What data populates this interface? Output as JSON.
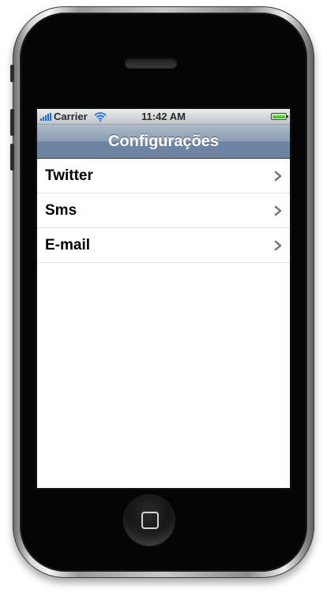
{
  "status_bar": {
    "carrier": "Carrier",
    "time": "11:42 AM",
    "battery_level": 1.0,
    "signal_icon": "signal-bars-icon",
    "wifi_icon": "wifi-icon",
    "battery_icon": "battery-icon"
  },
  "nav": {
    "title": "Configurações"
  },
  "settings": {
    "items": [
      {
        "label": "Twitter",
        "accessory_icon": "chevron-right-icon"
      },
      {
        "label": "Sms",
        "accessory_icon": "chevron-right-icon"
      },
      {
        "label": "E-mail",
        "accessory_icon": "chevron-right-icon"
      }
    ]
  },
  "device": {
    "home_button_icon": "home-button-icon",
    "nav_bar_color": "#6d84a2",
    "signal_color": "#1b6fd4",
    "battery_color": "#2eaa1b"
  }
}
